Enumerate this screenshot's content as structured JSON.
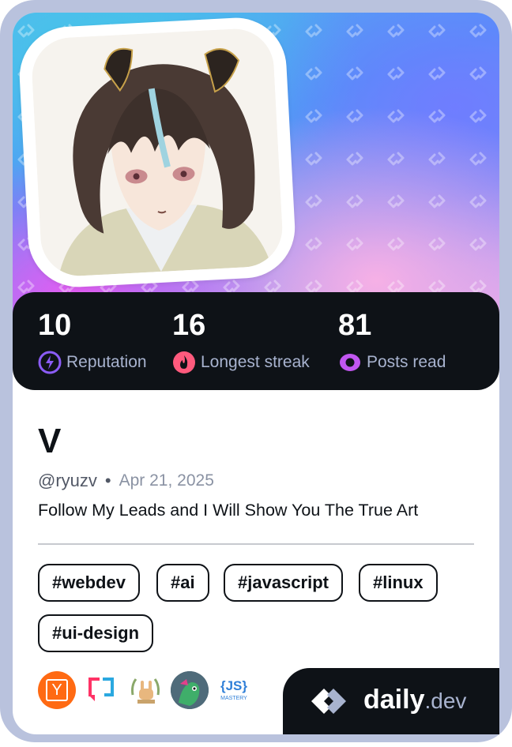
{
  "stats": [
    {
      "value": "10",
      "label": "Reputation",
      "icon": "reputation-bolt-icon",
      "color": "#8b5cf6"
    },
    {
      "value": "16",
      "label": "Longest streak",
      "icon": "streak-flame-icon",
      "color": "#ff5a7d"
    },
    {
      "value": "81",
      "label": "Posts read",
      "icon": "posts-read-icon",
      "color": "#c156f0"
    }
  ],
  "profile": {
    "name": "V",
    "handle": "@ryuzv",
    "separator": "•",
    "joined": "Apr 21, 2025",
    "bio": "Follow My Leads and I Will Show You The True Art"
  },
  "tags": [
    "#webdev",
    "#ai",
    "#javascript",
    "#linux",
    "#ui-design"
  ],
  "badges": [
    {
      "name": "y-combinator-badge-icon",
      "letter": "Y"
    },
    {
      "name": "chat-bubble-badge-icon"
    },
    {
      "name": "rock-hand-badge-icon"
    },
    {
      "name": "dino-avatar-badge-icon"
    },
    {
      "name": "js-mastery-badge-icon",
      "js": "{JS}",
      "mastery": "MASTERY"
    }
  ],
  "brand": {
    "name": "daily",
    "suffix": ".dev"
  },
  "colors": {
    "dark": "#0e1217",
    "muted": "#a8b3cf",
    "frame": "#b9c2dd"
  }
}
